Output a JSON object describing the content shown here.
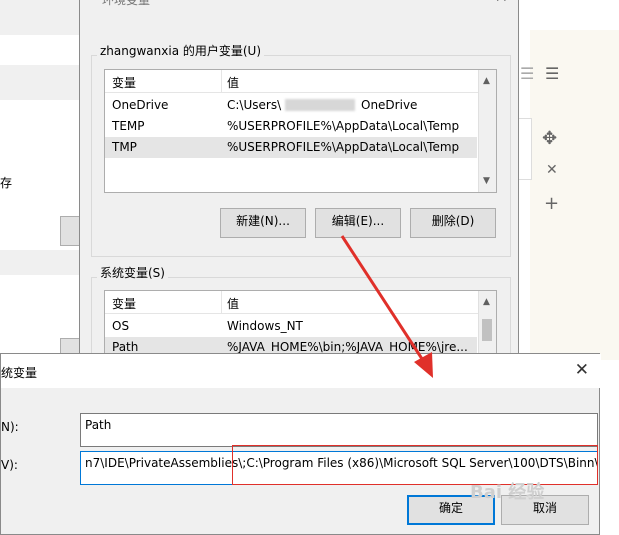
{
  "background_window": {
    "left_text": "存"
  },
  "env_dialog": {
    "title": "环境变量",
    "user_group_label": "zhangwanxia 的用户变量(U)",
    "columns": {
      "name": "变量",
      "value": "值"
    },
    "user_vars": [
      {
        "name": "OneDrive",
        "value": "C:\\Users\\",
        "value_suffix": "OneDrive"
      },
      {
        "name": "TEMP",
        "value": "%USERPROFILE%\\AppData\\Local\\Temp",
        "value_suffix": ""
      },
      {
        "name": "TMP",
        "value": "%USERPROFILE%\\AppData\\Local\\Temp",
        "value_suffix": ""
      }
    ],
    "buttons": {
      "new": "新建(N)...",
      "edit": "编辑(E)...",
      "delete": "删除(D)"
    },
    "system_group_label": "系统变量(S)",
    "system_vars": [
      {
        "name": "OS",
        "value": "Windows_NT"
      },
      {
        "name": "Path",
        "value": "%JAVA_HOME%\\bin;%JAVA_HOME%\\jre..."
      }
    ]
  },
  "edit_dialog": {
    "title": "统变量",
    "name_label": "N):",
    "value_label": "V):",
    "name_value": "Path",
    "value_value": "n7\\IDE\\PrivateAssemblies\\;C:\\Program Files (x86)\\Microsoft SQL Server\\100\\DTS\\Binn\\",
    "ok_label": "确定",
    "cancel_label": "取消"
  },
  "accent": {
    "highlight": "#e0302a",
    "focus": "#0078d7"
  },
  "watermark": "Bai 经验"
}
